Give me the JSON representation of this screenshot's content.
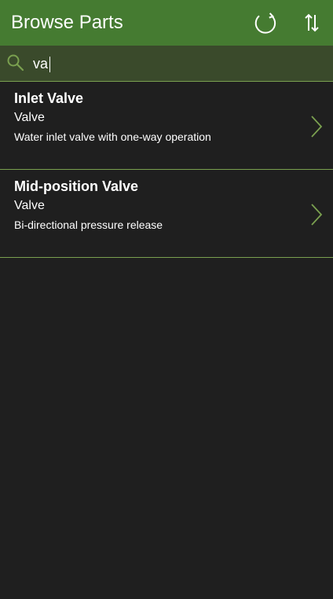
{
  "header": {
    "title": "Browse Parts",
    "refresh_icon": "refresh-icon",
    "sort_icon": "sort-icon"
  },
  "search": {
    "value": "va",
    "placeholder": ""
  },
  "colors": {
    "header_bg": "#457b31",
    "search_bg": "#3a4a2b",
    "accent": "#7aa04f",
    "background": "#1f1f1f",
    "text": "#ffffff"
  },
  "items": [
    {
      "title": "Inlet Valve",
      "category": "Valve",
      "description": "Water inlet valve with one-way operation",
      "icon": "chevron-right-icon"
    },
    {
      "title": "Mid-position Valve",
      "category": "Valve",
      "description": "Bi-directional pressure release",
      "icon": "chevron-right-icon"
    }
  ]
}
